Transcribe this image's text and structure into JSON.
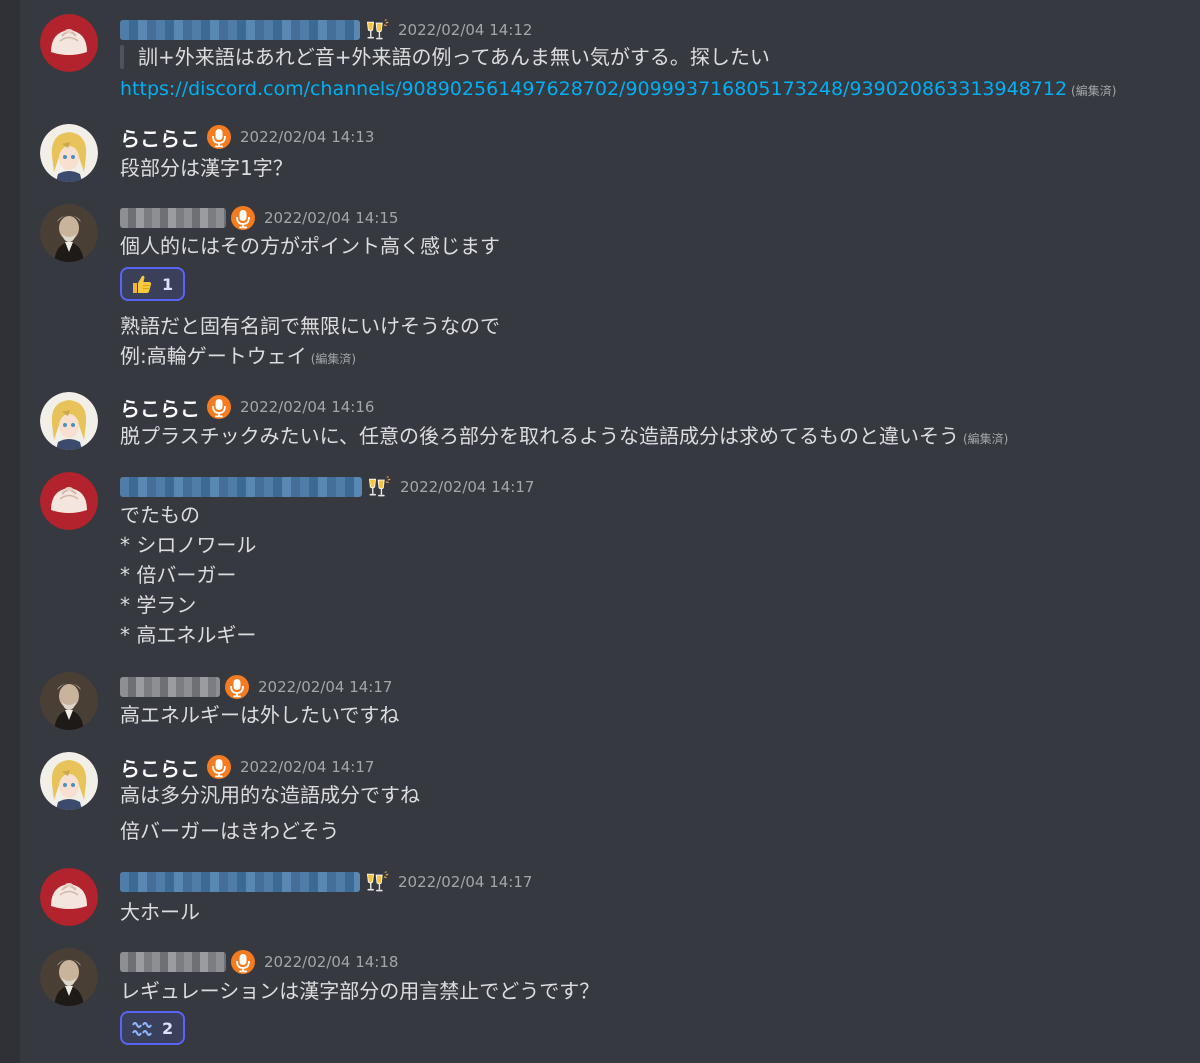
{
  "messages": [
    {
      "author_style": "blurred-blue",
      "badge": "champagne-icon",
      "timestamp": "2022/02/04 14:12",
      "lines": [
        {
          "text": "訓+外来語はあれど音+外来語の例ってあんま無い気がする。探したい"
        },
        {
          "text": "https://discord.com/channels/908902561497628702/909993716805173248/939020863313948712",
          "edited": "(編集済)"
        }
      ]
    },
    {
      "author": "らこらこ",
      "badge": "microphone-icon",
      "timestamp": "2022/02/04 14:13",
      "lines": [
        {
          "text": "段部分は漢字1字？"
        }
      ]
    },
    {
      "author_style": "blurred-gray",
      "badge": "microphone-icon",
      "timestamp": "2022/02/04 14:15",
      "lines": [
        {
          "text": "個人的にはその方がポイント高く感じます"
        },
        {
          "text": "熟語だと固有名詞で無限にいけそうなので"
        },
        {
          "text": "例:高輪ゲートウェイ",
          "edited": "(編集済)"
        }
      ],
      "reaction": {
        "icon": "thumbs-up-icon",
        "count": "1"
      }
    },
    {
      "author": "らこらこ",
      "badge": "microphone-icon",
      "timestamp": "2022/02/04 14:16",
      "lines": [
        {
          "text": "脱プラスチックみたいに、任意の後ろ部分を取れるような造語成分は求めてるものと違いそう",
          "edited": "(編集済)"
        }
      ]
    },
    {
      "author_style": "blurred-blue",
      "badge": "champagne-icon",
      "timestamp": "2022/02/04 14:17",
      "lines": [
        {
          "text": "でたもの"
        },
        {
          "text": "* シロノワール"
        },
        {
          "text": "* 倍バーガー"
        },
        {
          "text": "* 学ラン"
        },
        {
          "text": "* 高エネルギー"
        }
      ]
    },
    {
      "author_style": "blurred-gray",
      "badge": "microphone-icon",
      "timestamp": "2022/02/04 14:17",
      "lines": [
        {
          "text": "高エネルギーは外したいですね"
        }
      ]
    },
    {
      "author": "らこらこ",
      "badge": "microphone-icon",
      "timestamp": "2022/02/04 14:17",
      "lines": [
        {
          "text": "高は多分汎用的な造語成分ですね"
        },
        {
          "text": "倍バーガーはきわどそう"
        }
      ]
    },
    {
      "author_style": "blurred-blue",
      "badge": "champagne-icon",
      "timestamp": "2022/02/04 14:17",
      "lines": [
        {
          "text": "大ホール"
        }
      ]
    },
    {
      "author_style": "blurred-gray",
      "badge": "microphone-icon",
      "timestamp": "2022/02/04 14:18",
      "lines": [
        {
          "text": "レギュレーションは漢字部分の用言禁止でどうです？"
        }
      ],
      "reaction": {
        "icon": "wavy-emoji-icon",
        "count": "2"
      }
    }
  ],
  "colors": {
    "background": "#36393f",
    "text": "#dcddde",
    "timestamp": "#a3a6aa",
    "link": "#00aff4",
    "reaction_border": "#5865f2",
    "badge_orange": "#f57b20"
  }
}
